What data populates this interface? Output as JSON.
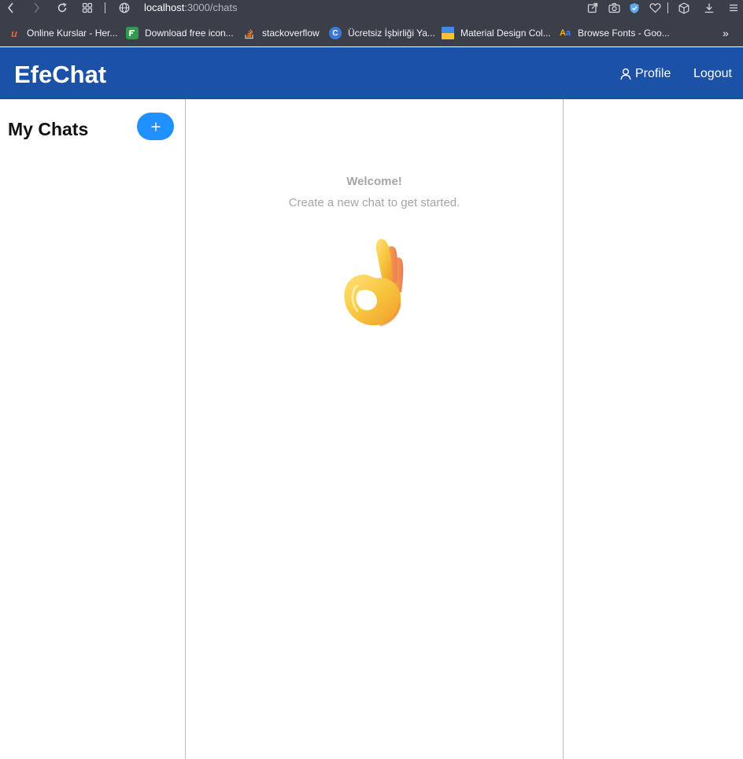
{
  "browser": {
    "url_host": "localhost",
    "url_path": ":3000/chats",
    "bookmarks": [
      {
        "label": "Online Kurslar - Her...",
        "icon": "udemy-icon",
        "color": "#e8663d"
      },
      {
        "label": "Download free icon...",
        "icon": "flaticon-icon",
        "color": "#2e9b4e"
      },
      {
        "label": "stackoverflow",
        "icon": "stackoverflow-icon",
        "color": "#f48024"
      },
      {
        "label": "Ücretsiz İşbirliği Ya...",
        "icon": "canva-icon",
        "color": "#3a7bd5"
      },
      {
        "label": "Material Design Col...",
        "icon": "material-icon",
        "color": "#f4c430"
      },
      {
        "label": "Browse Fonts - Goo...",
        "icon": "google-fonts-icon",
        "color": "#4285f4"
      }
    ],
    "overflow": "»"
  },
  "header": {
    "brand": "EfeChat",
    "profile_label": "Profile",
    "logout_label": "Logout",
    "background": "#1b52a7"
  },
  "sidebar": {
    "title": "My Chats",
    "add_button_label": "+",
    "add_button_color": "#1e90ff"
  },
  "main": {
    "welcome_title": "Welcome!",
    "welcome_subtitle": "Create a new chat to get started.",
    "illustration": "ok-hand-emoji"
  }
}
